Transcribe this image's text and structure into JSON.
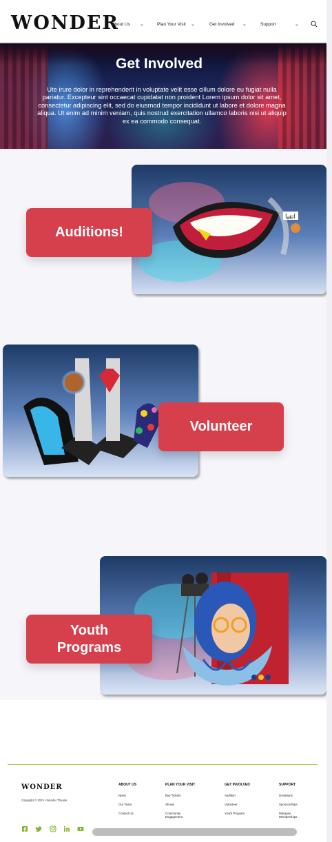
{
  "header": {
    "logo": "WONDER",
    "nav": [
      {
        "label": "About Us"
      },
      {
        "label": "Plan Your Visit"
      },
      {
        "label": "Get Involved"
      },
      {
        "label": "Support"
      }
    ]
  },
  "hero": {
    "title": "Get Involved",
    "text": "Ute irure dolor in reprehenderit in voluptate velit esse cillum dolore eu fugiat nulla pariatur. Excepteur sint occaecat cupidatat non proident Lorem ipsum dolor sit amet, consectetur adipiscing elit, sed do eiusmod tempor incididunt ut labore et dolore magna aliqua. Ut enim ad minim veniam, quis nostrud exercitation ullamco laboris nisi ut aliquip ex ea commodo consequat."
  },
  "sections": [
    {
      "button": "Auditions!",
      "image_sign": "اتقيا"
    },
    {
      "button": "Volunteer"
    },
    {
      "button": "Youth Programs",
      "button_line1": "Youth",
      "button_line2": "Programs"
    }
  ],
  "footer": {
    "logo": "WONDER",
    "copyright": "Copyright © 2023 • Wonder Theater",
    "columns": [
      {
        "heading": "ABOUT US",
        "links": [
          "News",
          "Our Team",
          "Contact Us"
        ]
      },
      {
        "heading": "PLAN YOUR VISIT",
        "links": [
          "Buy Tickets",
          "Shows",
          "Community Engagement"
        ]
      },
      {
        "heading": "GET INVOLVED",
        "links": [
          "Audition",
          "Volunteer",
          "Youth Program"
        ]
      },
      {
        "heading": "SUPPORT",
        "links": [
          "Donations",
          "Sponsorships",
          "Marquee Memberships"
        ]
      }
    ],
    "social": [
      "facebook-icon",
      "twitter-icon",
      "instagram-icon",
      "linkedin-icon",
      "youtube-icon"
    ],
    "social_color": "#86b52d"
  },
  "colors": {
    "accent": "#d6404d",
    "footer_rule": "#b9c95a",
    "section_bg": "#f6f6fa"
  }
}
